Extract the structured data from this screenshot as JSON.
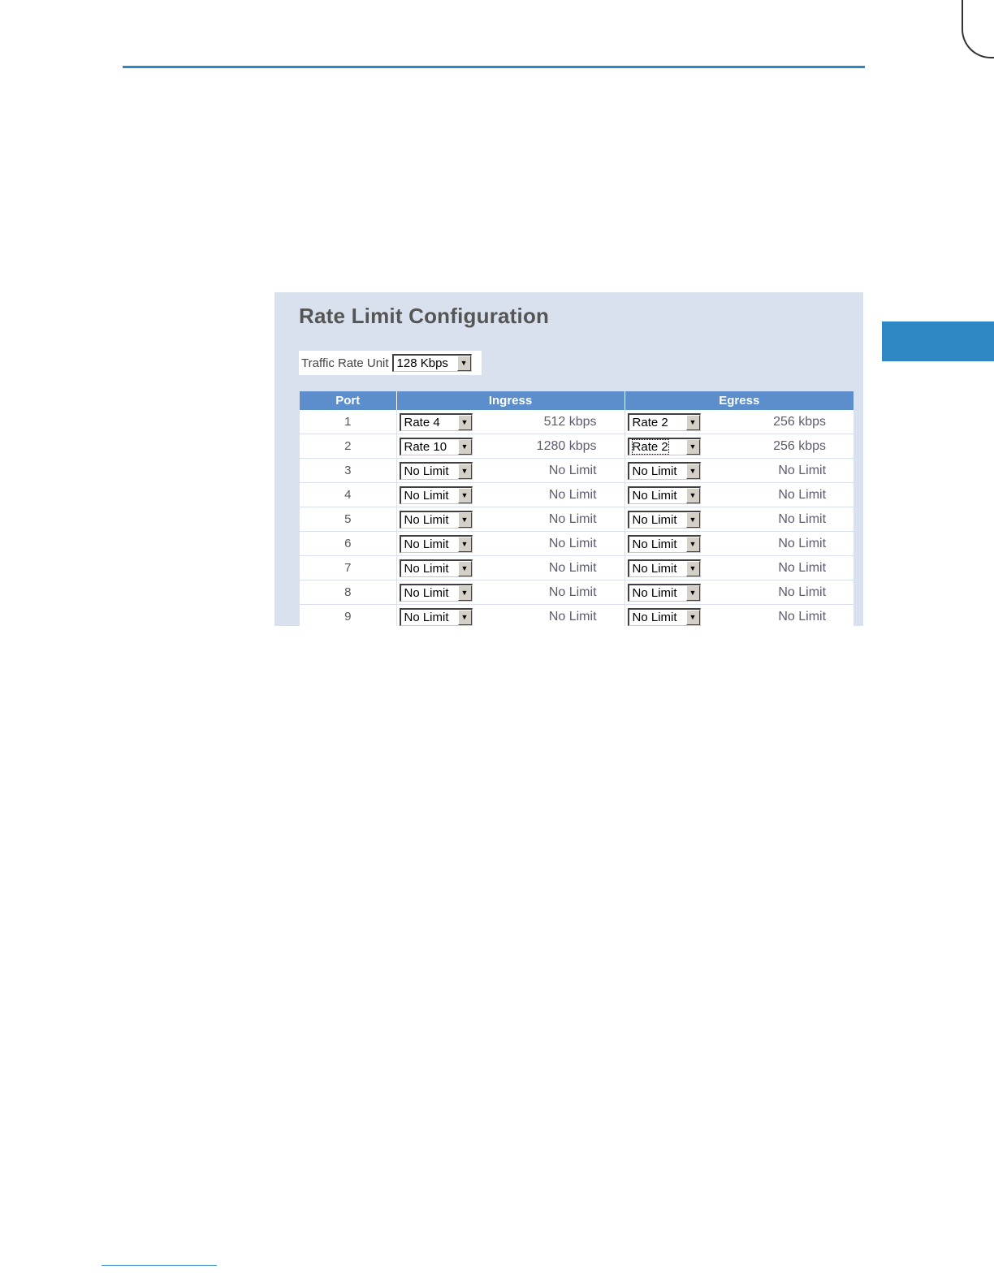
{
  "panel": {
    "title": "Rate Limit Configuration",
    "traffic_rate_unit": {
      "label": "Traffic Rate Unit",
      "value": "128 Kbps"
    }
  },
  "table": {
    "headers": {
      "port": "Port",
      "ingress": "Ingress",
      "egress": "Egress"
    },
    "rows": [
      {
        "port": "1",
        "ingress_select": "Rate 4",
        "ingress_value": "512 kbps",
        "egress_select": "Rate 2",
        "egress_value": "256 kbps"
      },
      {
        "port": "2",
        "ingress_select": "Rate 10",
        "ingress_value": "1280 kbps",
        "egress_select": "Rate 2",
        "egress_value": "256 kbps"
      },
      {
        "port": "3",
        "ingress_select": "No Limit",
        "ingress_value": "No Limit",
        "egress_select": "No Limit",
        "egress_value": "No Limit"
      },
      {
        "port": "4",
        "ingress_select": "No Limit",
        "ingress_value": "No Limit",
        "egress_select": "No Limit",
        "egress_value": "No Limit"
      },
      {
        "port": "5",
        "ingress_select": "No Limit",
        "ingress_value": "No Limit",
        "egress_select": "No Limit",
        "egress_value": "No Limit"
      },
      {
        "port": "6",
        "ingress_select": "No Limit",
        "ingress_value": "No Limit",
        "egress_select": "No Limit",
        "egress_value": "No Limit"
      },
      {
        "port": "7",
        "ingress_select": "No Limit",
        "ingress_value": "No Limit",
        "egress_select": "No Limit",
        "egress_value": "No Limit"
      },
      {
        "port": "8",
        "ingress_select": "No Limit",
        "ingress_value": "No Limit",
        "egress_select": "No Limit",
        "egress_value": "No Limit"
      },
      {
        "port": "9",
        "ingress_select": "No Limit",
        "ingress_value": "No Limit",
        "egress_select": "No Limit",
        "egress_value": "No Limit"
      }
    ]
  },
  "icons": {
    "dropdown": "chevron-down-icon"
  },
  "colors": {
    "accent": "#2f86c4",
    "panel_background": "#d9e1ee",
    "table_header": "#5b8ecb"
  }
}
